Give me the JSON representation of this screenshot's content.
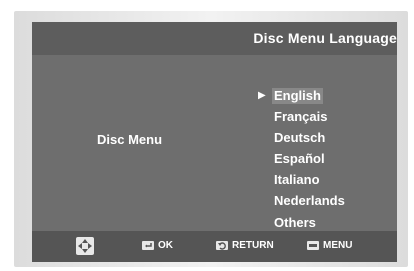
{
  "header": {
    "title": "Disc Menu Language"
  },
  "section": {
    "label": "Disc Menu"
  },
  "languages": [
    {
      "label": "English",
      "selected": true
    },
    {
      "label": "Français",
      "selected": false
    },
    {
      "label": "Deutsch",
      "selected": false
    },
    {
      "label": "Español",
      "selected": false
    },
    {
      "label": "Italiano",
      "selected": false
    },
    {
      "label": "Nederlands",
      "selected": false
    },
    {
      "label": "Others",
      "selected": false
    }
  ],
  "selection_marker": "▶",
  "footer": {
    "navigate_icon": "dpad-icon",
    "ok_label": "OK",
    "ok_icon": "enter-icon",
    "return_label": "RETURN",
    "return_icon": "return-icon",
    "menu_label": "MENU",
    "menu_icon": "menu-icon"
  },
  "colors": {
    "header_bg": "#5d5d5d",
    "main_bg": "#6e6e6e",
    "footer_bg": "#555555",
    "highlight": "#888888",
    "text": "#ffffff"
  }
}
